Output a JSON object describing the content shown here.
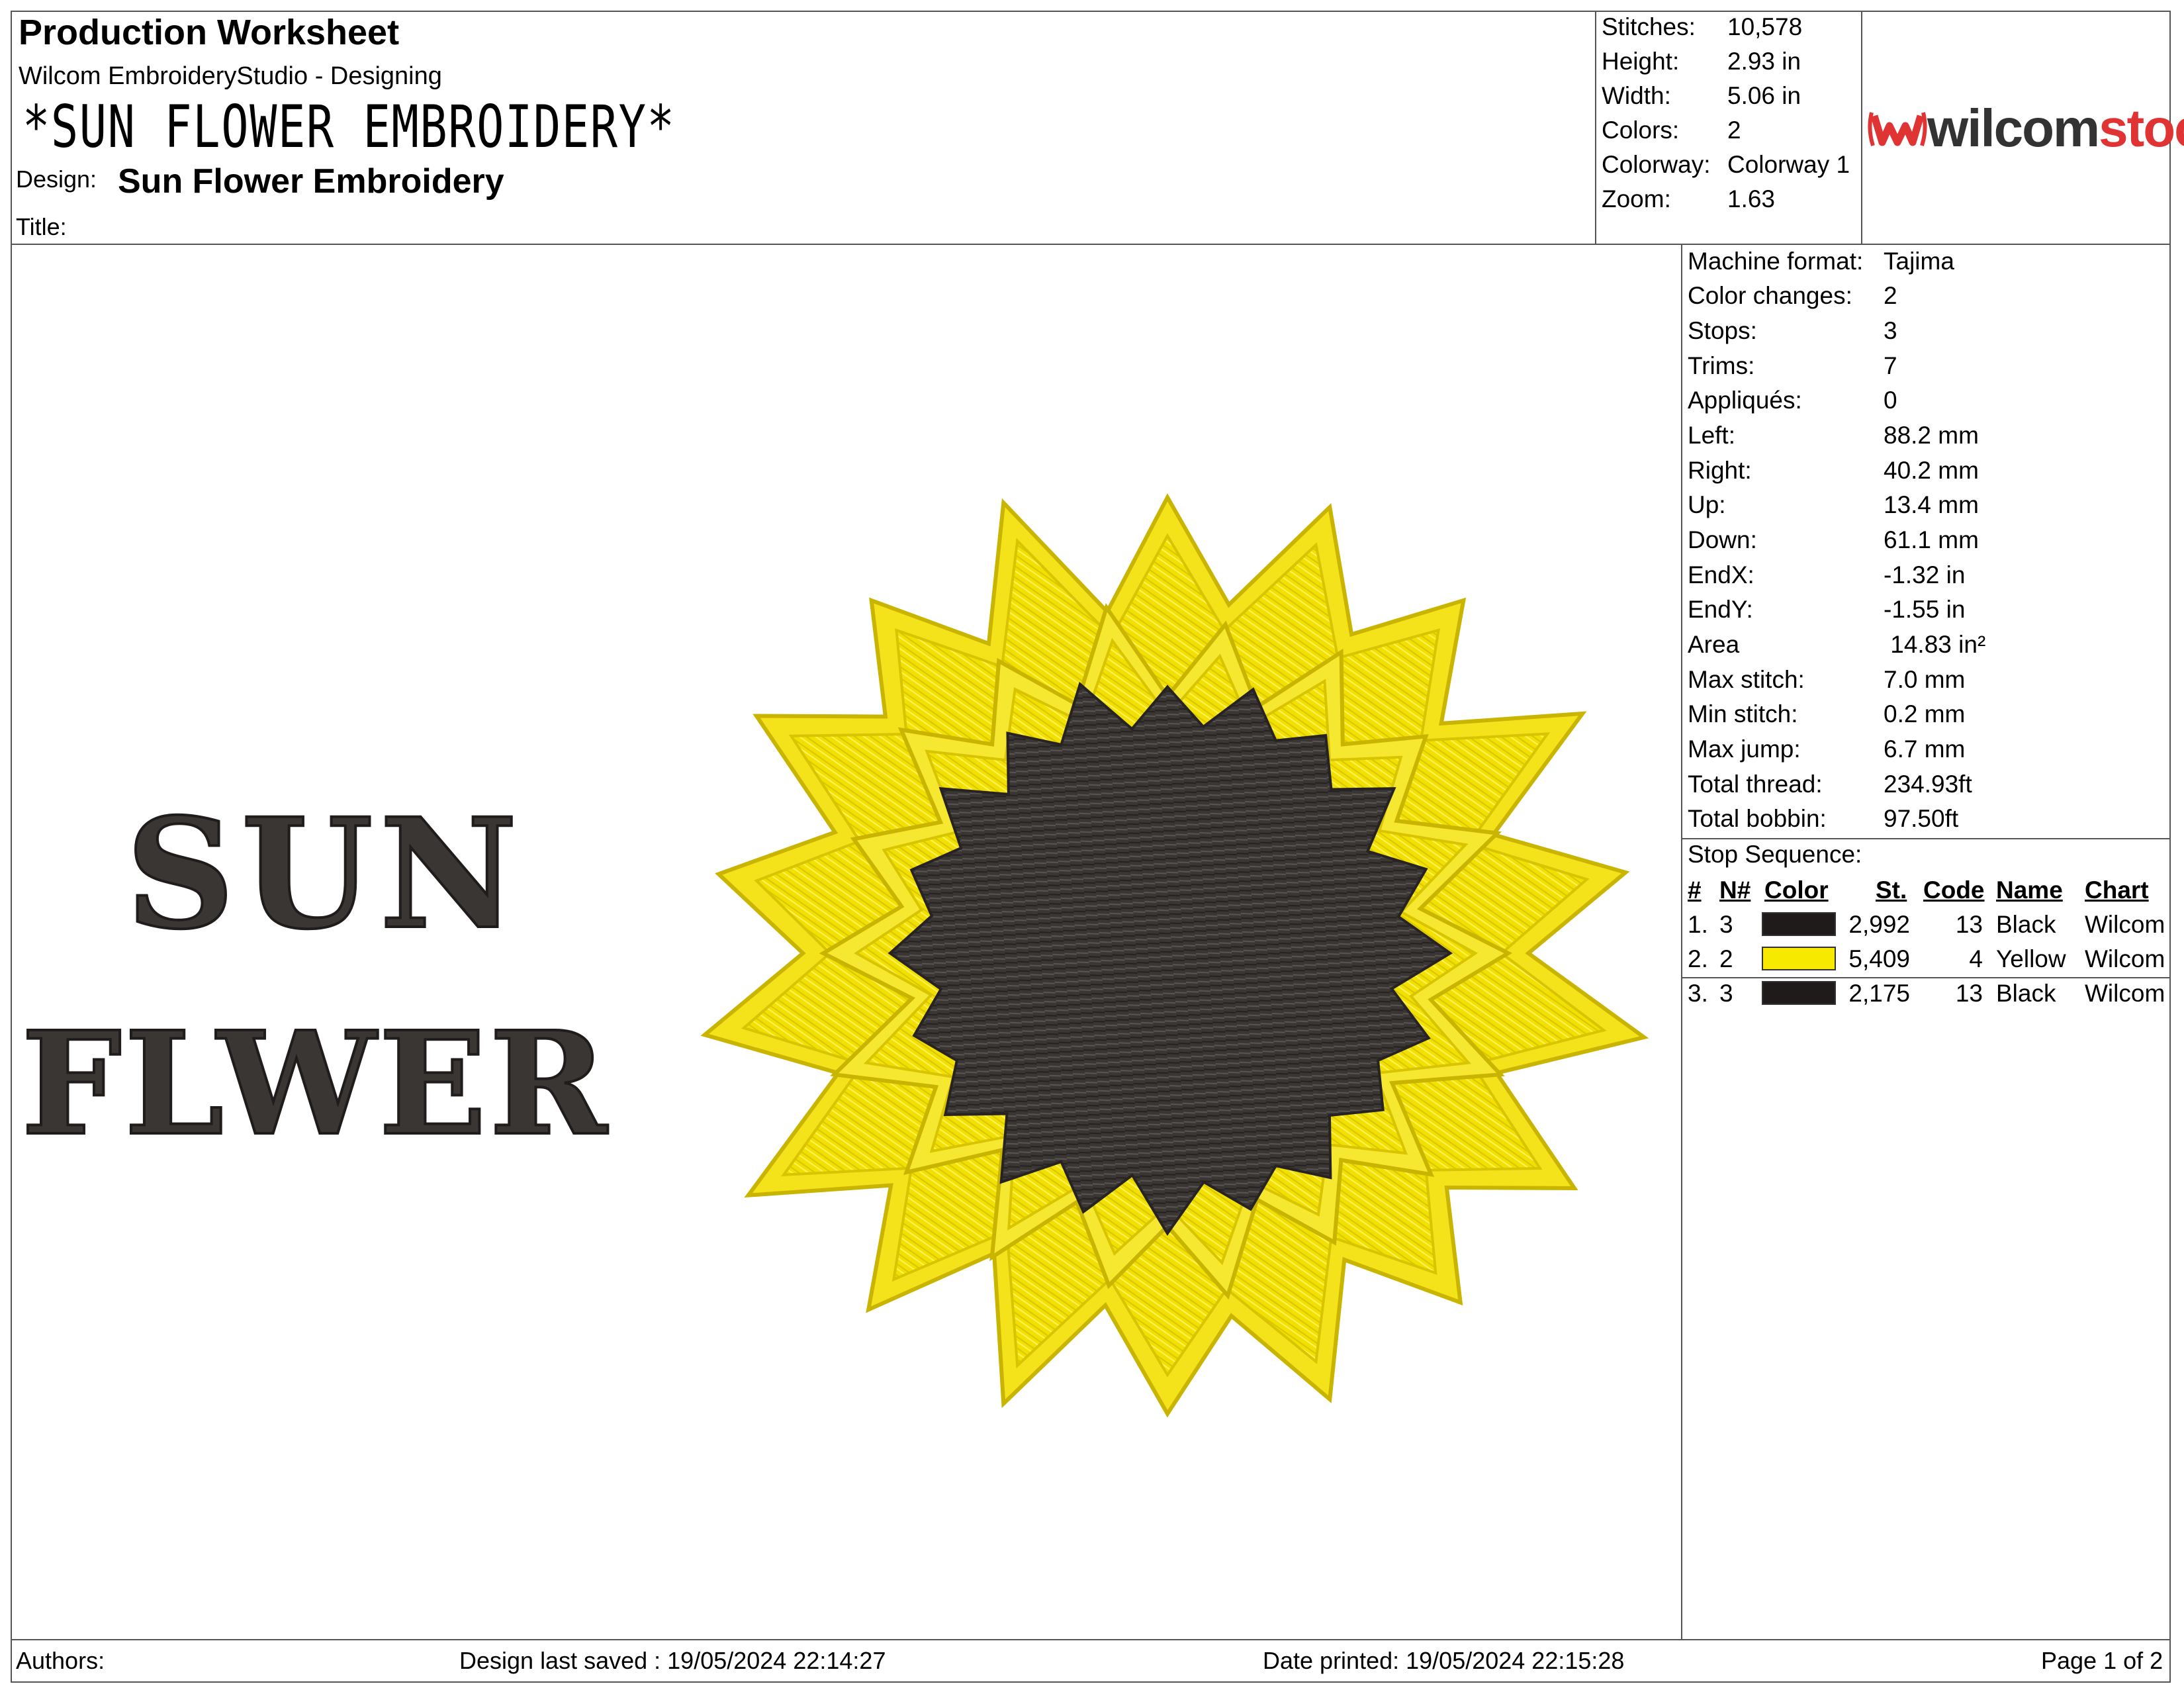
{
  "header": {
    "title": "Production Worksheet",
    "software": "Wilcom EmbroideryStudio - Designing",
    "file_name": "*SUN FLOWER EMBROIDERY*",
    "design_label": "Design:",
    "design_value": "Sun Flower Embroidery",
    "title_label": "Title:",
    "title_value": ""
  },
  "summary": [
    {
      "label": "Stitches:",
      "value": "10,578"
    },
    {
      "label": "Height:",
      "value": "2.93 in"
    },
    {
      "label": "Width:",
      "value": "5.06 in"
    },
    {
      "label": "Colors:",
      "value": "2"
    },
    {
      "label": "Colorway:",
      "value": "Colorway 1"
    },
    {
      "label": "Zoom:",
      "value": "1.63"
    }
  ],
  "logo": {
    "part1": "wilcom",
    "part2": "stock",
    "brand_color": "#e03333"
  },
  "details": [
    {
      "label": "Machine format:",
      "value": "Tajima"
    },
    {
      "label": "Color changes:",
      "value": "2"
    },
    {
      "label": "Stops:",
      "value": "3"
    },
    {
      "label": "Trims:",
      "value": "7"
    },
    {
      "label": "Appliqués:",
      "value": "0"
    },
    {
      "label": "Left:",
      "value": "88.2 mm"
    },
    {
      "label": "Right:",
      "value": "40.2 mm"
    },
    {
      "label": "Up:",
      "value": "13.4 mm"
    },
    {
      "label": "Down:",
      "value": "61.1 mm"
    },
    {
      "label": "EndX:",
      "value": "-1.32 in"
    },
    {
      "label": "EndY:",
      "value": "-1.55 in"
    },
    {
      "label": "Area",
      "value": " 14.83 in²"
    },
    {
      "label": "Max stitch:",
      "value": "7.0 mm"
    },
    {
      "label": "Min stitch:",
      "value": "0.2 mm"
    },
    {
      "label": "Max jump:",
      "value": "6.7 mm"
    },
    {
      "label": "Total thread:",
      "value": "234.93ft"
    },
    {
      "label": "Total bobbin:",
      "value": "97.50ft"
    }
  ],
  "stop_sequence": {
    "title": "Stop Sequence:",
    "headers": [
      "#",
      "N#",
      "Color",
      "St.",
      "Code",
      "Name",
      "Chart"
    ],
    "rows": [
      {
        "idx": "1.",
        "n": "3",
        "color": "#1e1b1a",
        "st": "2,992",
        "code": "13",
        "name": "Black",
        "chart": "Wilcom"
      },
      {
        "idx": "2.",
        "n": "2",
        "color": "#f7ea00",
        "st": "5,409",
        "code": "4",
        "name": "Yellow",
        "chart": "Wilcom"
      },
      {
        "idx": "3.",
        "n": "3",
        "color": "#1e1b1a",
        "st": "2,175",
        "code": "13",
        "name": "Black",
        "chart": "Wilcom"
      }
    ]
  },
  "design_preview": {
    "line1": "SUN",
    "line2": "FLWER",
    "thread_dark": "#3a3634",
    "thread_yellow": "#f2e000"
  },
  "footer": {
    "authors": "Authors:",
    "saved": "Design last saved : 19/05/2024 22:14:27",
    "printed": "Date printed: 19/05/2024 22:15:28",
    "page": "Page 1 of 2"
  }
}
